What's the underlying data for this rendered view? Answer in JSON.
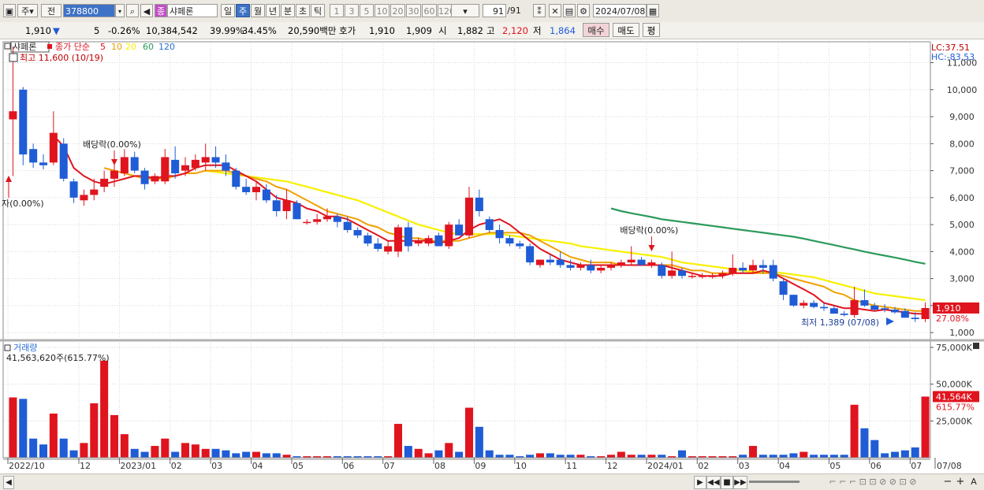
{
  "toolbar": {
    "period_selector": "주",
    "view_selector": "전",
    "stock_code": "378800",
    "stock_name": "샤페론",
    "stock_badge": "종",
    "intervals": [
      "일",
      "주",
      "월",
      "년",
      "분",
      "초",
      "틱"
    ],
    "selected_interval": "주",
    "minute_options": [
      "1",
      "3",
      "5",
      "10",
      "20",
      "30",
      "60",
      "120"
    ],
    "page_current": "91",
    "page_total": "/91",
    "date": "2024/07/08"
  },
  "infobar": {
    "price": "1,910",
    "change_arrow": "▼",
    "change": "5",
    "change_pct": "-0.26%",
    "volume": "10,384,542",
    "turnover_pct": "39.99%",
    "ratio_pct": "34.45%",
    "trade_value": "20,590백만",
    "quote_label": "호가",
    "ask": "1,910",
    "bid": "1,909",
    "open_label": "시",
    "open": "1,882",
    "high_label": "고",
    "high": "2,120",
    "low_label": "저",
    "low": "1,864",
    "buy_button": "매수",
    "sell_button": "매도",
    "eval_button": "평"
  },
  "chart_data": {
    "type": "candlestick",
    "title": "샤페론",
    "legend": {
      "prefix": "종가 단순",
      "ma_labels": [
        "5",
        "10",
        "20",
        "60",
        "120"
      ]
    },
    "ma_colors": {
      "5": "#e0141e",
      "10": "#f0a000",
      "20": "#f8f000",
      "60": "#2a9a5a",
      "120": "#2a6fd6"
    },
    "up_color": "#e0141e",
    "down_color": "#1f5cd6",
    "corner_labels": {
      "lc": "LC:37.51",
      "hc": "HC:-83.53"
    },
    "price_ylim": [
      800,
      11600
    ],
    "y_ticks": [
      1000,
      2000,
      3000,
      4000,
      5000,
      6000,
      7000,
      8000,
      9000,
      10000,
      11000
    ],
    "y_tick_labels": [
      "1,000",
      "2,000",
      "3,000",
      "4,000",
      "5,000",
      "6,000",
      "7,000",
      "8,000",
      "9,000",
      "10,000",
      "11,000"
    ],
    "annotations": {
      "high": "최고 11,600 (10/19)",
      "low": "최저 1,389 (07/08)",
      "ex_div_1": "배당락(0.00%)",
      "ex_div_2": "배당락(0.00%)",
      "ex_div_left": "자(0.00%)"
    },
    "last_price_label": "1,910",
    "last_change_label": "27.08%",
    "x_labels": [
      {
        "i": 0,
        "t": "2022/10"
      },
      {
        "i": 7,
        "t": "12"
      },
      {
        "i": 11,
        "t": "2023/01"
      },
      {
        "i": 16,
        "t": "02"
      },
      {
        "i": 20,
        "t": "03"
      },
      {
        "i": 24,
        "t": "04"
      },
      {
        "i": 28,
        "t": "05"
      },
      {
        "i": 33,
        "t": "06"
      },
      {
        "i": 37,
        "t": "07"
      },
      {
        "i": 42,
        "t": "08"
      },
      {
        "i": 46,
        "t": "09"
      },
      {
        "i": 50,
        "t": "10"
      },
      {
        "i": 55,
        "t": "11"
      },
      {
        "i": 59,
        "t": "12"
      },
      {
        "i": 63,
        "t": "2024/01"
      },
      {
        "i": 68,
        "t": "02"
      },
      {
        "i": 72,
        "t": "03"
      },
      {
        "i": 76,
        "t": "04"
      },
      {
        "i": 81,
        "t": "05"
      },
      {
        "i": 85,
        "t": "06"
      },
      {
        "i": 89,
        "t": "07"
      }
    ],
    "last_date_label": "07/08",
    "candles": [
      [
        8900,
        11600,
        6800,
        9200
      ],
      [
        10000,
        10100,
        7200,
        7600
      ],
      [
        7800,
        8000,
        7100,
        7300
      ],
      [
        7300,
        7600,
        7050,
        7200
      ],
      [
        7300,
        9200,
        7200,
        8400
      ],
      [
        8000,
        8200,
        6600,
        6700
      ],
      [
        6600,
        6700,
        5800,
        6000
      ],
      [
        5900,
        6300,
        5700,
        6100
      ],
      [
        6100,
        6700,
        5900,
        6300
      ],
      [
        6400,
        7000,
        6200,
        6700
      ],
      [
        6700,
        7400,
        6400,
        7000
      ],
      [
        6900,
        7800,
        6800,
        7500
      ],
      [
        7500,
        7700,
        6900,
        7000
      ],
      [
        7000,
        7100,
        6300,
        6500
      ],
      [
        6600,
        6900,
        6500,
        6800
      ],
      [
        6600,
        7800,
        6500,
        7500
      ],
      [
        7400,
        7900,
        6700,
        6900
      ],
      [
        7000,
        7500,
        6800,
        7200
      ],
      [
        7100,
        7600,
        7000,
        7400
      ],
      [
        7300,
        8000,
        7000,
        7500
      ],
      [
        7500,
        7900,
        7100,
        7300
      ],
      [
        7300,
        7600,
        6800,
        7000
      ],
      [
        7000,
        7100,
        6300,
        6400
      ],
      [
        6400,
        6700,
        6100,
        6200
      ],
      [
        6200,
        6600,
        5900,
        6400
      ],
      [
        6300,
        6500,
        5800,
        5900
      ],
      [
        5900,
        6100,
        5300,
        5500
      ],
      [
        5500,
        6300,
        5200,
        5900
      ],
      [
        5800,
        5900,
        5200,
        5200
      ],
      [
        5100,
        5200,
        5000,
        5100
      ],
      [
        5100,
        5400,
        5000,
        5200
      ],
      [
        5200,
        5600,
        5100,
        5300
      ],
      [
        5300,
        5400,
        4900,
        5100
      ],
      [
        5100,
        5300,
        4700,
        4800
      ],
      [
        4800,
        4900,
        4500,
        4600
      ],
      [
        4600,
        4700,
        4200,
        4300
      ],
      [
        4300,
        4500,
        4000,
        4100
      ],
      [
        4000,
        4400,
        3900,
        4200
      ],
      [
        4000,
        5000,
        3800,
        4900
      ],
      [
        4900,
        5100,
        4000,
        4200
      ],
      [
        4300,
        4500,
        4200,
        4400
      ],
      [
        4300,
        4600,
        4200,
        4500
      ],
      [
        4600,
        4700,
        4200,
        4200
      ],
      [
        4200,
        5100,
        4100,
        5000
      ],
      [
        5000,
        5200,
        4600,
        4600
      ],
      [
        4600,
        6400,
        4500,
        6000
      ],
      [
        6000,
        6300,
        5300,
        5500
      ],
      [
        5200,
        5300,
        4700,
        4800
      ],
      [
        4800,
        5000,
        4300,
        4500
      ],
      [
        4500,
        4600,
        4200,
        4300
      ],
      [
        4300,
        4400,
        4100,
        4200
      ],
      [
        4200,
        4300,
        3500,
        3600
      ],
      [
        3500,
        3700,
        3400,
        3700
      ],
      [
        3700,
        3900,
        3500,
        3600
      ],
      [
        3700,
        4000,
        3400,
        3500
      ],
      [
        3500,
        3700,
        3300,
        3400
      ],
      [
        3400,
        3600,
        3300,
        3500
      ],
      [
        3500,
        3700,
        3200,
        3300
      ],
      [
        3300,
        3500,
        3200,
        3400
      ],
      [
        3400,
        3600,
        3300,
        3500
      ],
      [
        3500,
        3700,
        3400,
        3600
      ],
      [
        3600,
        4200,
        3500,
        3700
      ],
      [
        3700,
        3800,
        3500,
        3500
      ],
      [
        3500,
        3700,
        3400,
        3600
      ],
      [
        3500,
        3600,
        3000,
        3100
      ],
      [
        3100,
        4000,
        3000,
        3300
      ],
      [
        3300,
        3400,
        3000,
        3100
      ],
      [
        3100,
        3200,
        3000,
        3100
      ],
      [
        3100,
        3200,
        3000,
        3100
      ],
      [
        3100,
        3200,
        3000,
        3100
      ],
      [
        3100,
        3300,
        3000,
        3200
      ],
      [
        3200,
        3900,
        3100,
        3400
      ],
      [
        3400,
        3600,
        3200,
        3300
      ],
      [
        3300,
        3700,
        3200,
        3500
      ],
      [
        3500,
        3700,
        3200,
        3400
      ],
      [
        3500,
        3700,
        2900,
        3000
      ],
      [
        2900,
        3000,
        2200,
        2400
      ],
      [
        2400,
        2400,
        1950,
        2000
      ],
      [
        2000,
        2200,
        1900,
        2100
      ],
      [
        2100,
        2200,
        1900,
        1950
      ],
      [
        1950,
        2100,
        1800,
        1900
      ],
      [
        1900,
        2000,
        1700,
        1700
      ],
      [
        1700,
        1800,
        1600,
        1650
      ],
      [
        1650,
        2700,
        1550,
        2200
      ],
      [
        2200,
        2600,
        1950,
        2000
      ],
      [
        2000,
        2100,
        1800,
        1850
      ],
      [
        1900,
        2050,
        1750,
        1850
      ],
      [
        1850,
        1950,
        1700,
        1750
      ],
      [
        1800,
        1900,
        1550,
        1550
      ],
      [
        1550,
        1750,
        1389,
        1500
      ],
      [
        1500,
        2120,
        1389,
        1910
      ]
    ],
    "ma5": [
      null,
      null,
      null,
      null,
      8300,
      7900,
      7100,
      6800,
      6600,
      6500,
      6600,
      6700,
      6800,
      6800,
      6700,
      6800,
      6800,
      6900,
      7100,
      7200,
      7200,
      7200,
      7000,
      6800,
      6600,
      6300,
      6000,
      5900,
      5800,
      5600,
      5500,
      5300,
      5300,
      5200,
      5000,
      4800,
      4600,
      4400,
      4400,
      4400,
      4400,
      4400,
      4300,
      4400,
      4500,
      4800,
      5000,
      5100,
      5200,
      5000,
      4700,
      4400,
      4100,
      3900,
      3700,
      3600,
      3500,
      3500,
      3500,
      3500,
      3500,
      3500,
      3500,
      3500,
      3500,
      3400,
      3300,
      3200,
      3100,
      3100,
      3100,
      3200,
      3200,
      3200,
      3300,
      3200,
      3000,
      2800,
      2600,
      2400,
      2100,
      2000,
      1900,
      1900,
      1850,
      1800,
      1850,
      1800,
      1750,
      1700,
      1700
    ],
    "ma10": [
      null,
      null,
      null,
      null,
      null,
      null,
      null,
      null,
      null,
      7100,
      7000,
      6900,
      6800,
      6700,
      6700,
      6700,
      6800,
      6900,
      6900,
      7000,
      7000,
      7000,
      6900,
      6800,
      6700,
      6600,
      6400,
      6300,
      6100,
      5900,
      5700,
      5500,
      5400,
      5300,
      5200,
      5000,
      4900,
      4700,
      4600,
      4500,
      4500,
      4400,
      4400,
      4400,
      4400,
      4500,
      4600,
      4700,
      4700,
      4700,
      4700,
      4600,
      4400,
      4200,
      4000,
      3800,
      3700,
      3600,
      3600,
      3600,
      3500,
      3500,
      3500,
      3500,
      3500,
      3500,
      3400,
      3300,
      3300,
      3200,
      3200,
      3200,
      3200,
      3200,
      3200,
      3200,
      3100,
      3000,
      2900,
      2800,
      2700,
      2500,
      2400,
      2200,
      2100,
      2000,
      1950,
      1900,
      1850,
      1800,
      1800
    ],
    "ma20": [
      null,
      null,
      null,
      null,
      null,
      null,
      null,
      null,
      null,
      null,
      null,
      null,
      null,
      null,
      null,
      null,
      null,
      null,
      null,
      7000,
      6950,
      6900,
      6850,
      6800,
      6750,
      6700,
      6650,
      6600,
      6500,
      6400,
      6300,
      6200,
      6100,
      6000,
      5900,
      5750,
      5600,
      5450,
      5300,
      5150,
      5000,
      4900,
      4800,
      4700,
      4650,
      4650,
      4650,
      4650,
      4650,
      4600,
      4550,
      4500,
      4450,
      4400,
      4350,
      4300,
      4200,
      4150,
      4100,
      4050,
      4000,
      3950,
      3900,
      3850,
      3800,
      3700,
      3600,
      3550,
      3500,
      3450,
      3400,
      3350,
      3300,
      3250,
      3250,
      3250,
      3200,
      3150,
      3100,
      3050,
      2950,
      2850,
      2750,
      2650,
      2550,
      2450,
      2400,
      2350,
      2300,
      2250,
      2200
    ],
    "ma60": [
      null,
      null,
      null,
      null,
      null,
      null,
      null,
      null,
      null,
      null,
      null,
      null,
      null,
      null,
      null,
      null,
      null,
      null,
      null,
      null,
      null,
      null,
      null,
      null,
      null,
      null,
      null,
      null,
      null,
      null,
      null,
      null,
      null,
      null,
      null,
      null,
      null,
      null,
      null,
      null,
      null,
      null,
      null,
      null,
      null,
      null,
      null,
      null,
      null,
      null,
      null,
      null,
      null,
      null,
      null,
      null,
      null,
      null,
      null,
      5600,
      5500,
      5420,
      5350,
      5280,
      5200,
      5150,
      5100,
      5050,
      5000,
      4950,
      4900,
      4850,
      4800,
      4750,
      4700,
      4650,
      4600,
      4550,
      4480,
      4400,
      4320,
      4240,
      4160,
      4080,
      4000,
      3920,
      3850,
      3780,
      3700,
      3620,
      3550
    ],
    "volume_ylim": [
      0,
      75000
    ],
    "volume_y_ticks": [
      25000,
      50000,
      75000
    ],
    "volume_y_tick_labels": [
      "25,000K",
      "50,000K",
      "75,000K"
    ],
    "volume_title": "거래량",
    "volume_annotation": "41,563,620주(615.77%)",
    "volume_last_label": "41,564K",
    "volume_last_pct": "615.77%",
    "volume": [
      41000,
      40000,
      13000,
      9000,
      30000,
      13000,
      5000,
      10000,
      37000,
      66000,
      29000,
      16000,
      6000,
      4000,
      8000,
      13000,
      4000,
      10000,
      9000,
      6000,
      6000,
      5000,
      3000,
      4000,
      4000,
      3000,
      3000,
      2000,
      1000,
      1000,
      1000,
      1000,
      1000,
      1000,
      1000,
      1000,
      1000,
      1000,
      23000,
      8000,
      6000,
      3000,
      5000,
      10000,
      4000,
      34000,
      21000,
      5000,
      2000,
      2000,
      1000,
      2000,
      3000,
      3000,
      2000,
      2000,
      2000,
      1000,
      1000,
      2000,
      4000,
      2000,
      2000,
      2000,
      2000,
      1000,
      5000,
      1000,
      1000,
      1000,
      1000,
      1000,
      2000,
      8000,
      2000,
      2000,
      2000,
      3000,
      4000,
      2000,
      2000,
      2000,
      2000,
      36000,
      20000,
      12000,
      3000,
      4000,
      5000,
      7000,
      41564
    ]
  },
  "statusbar": {
    "controls": [
      "▶",
      "◀◀",
      "■",
      "▶▶"
    ],
    "zoom": [
      "−",
      "+",
      "A"
    ]
  }
}
